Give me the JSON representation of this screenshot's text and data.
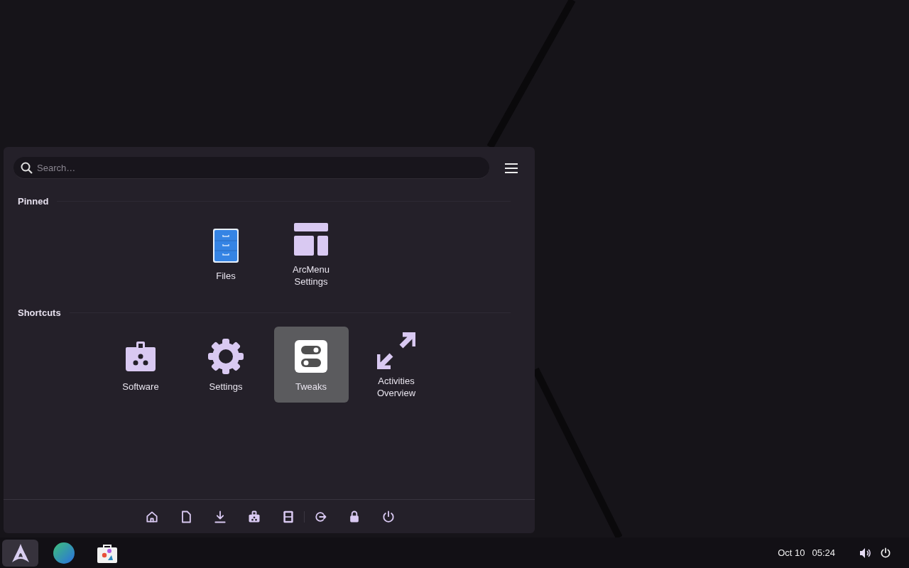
{
  "menu": {
    "search": {
      "placeholder": "Search…"
    },
    "sections": [
      {
        "title": "Pinned",
        "items": [
          {
            "label": "Files",
            "kind": "files",
            "selected": false
          },
          {
            "label": "ArcMenu Settings",
            "kind": "layout",
            "selected": false
          }
        ]
      },
      {
        "title": "Shortcuts",
        "items": [
          {
            "label": "Software",
            "kind": "bag",
            "selected": false
          },
          {
            "label": "Settings",
            "kind": "gear",
            "selected": false
          },
          {
            "label": "Tweaks",
            "kind": "toggles",
            "selected": true
          },
          {
            "label": "Activities Overview",
            "kind": "arrows",
            "selected": false
          }
        ]
      }
    ],
    "footer_groups": [
      [
        {
          "kind": "home"
        },
        {
          "kind": "document"
        },
        {
          "kind": "download"
        },
        {
          "kind": "bag"
        },
        {
          "kind": "cabinet"
        }
      ],
      [
        {
          "kind": "logout"
        },
        {
          "kind": "lock"
        },
        {
          "kind": "power"
        }
      ]
    ]
  },
  "taskbar": {
    "apps": [
      {
        "kind": "arch",
        "selected": true
      },
      {
        "kind": "globe",
        "selected": false
      },
      {
        "kind": "store",
        "selected": false
      }
    ],
    "date": "Oct 10",
    "time": "05:24"
  }
}
